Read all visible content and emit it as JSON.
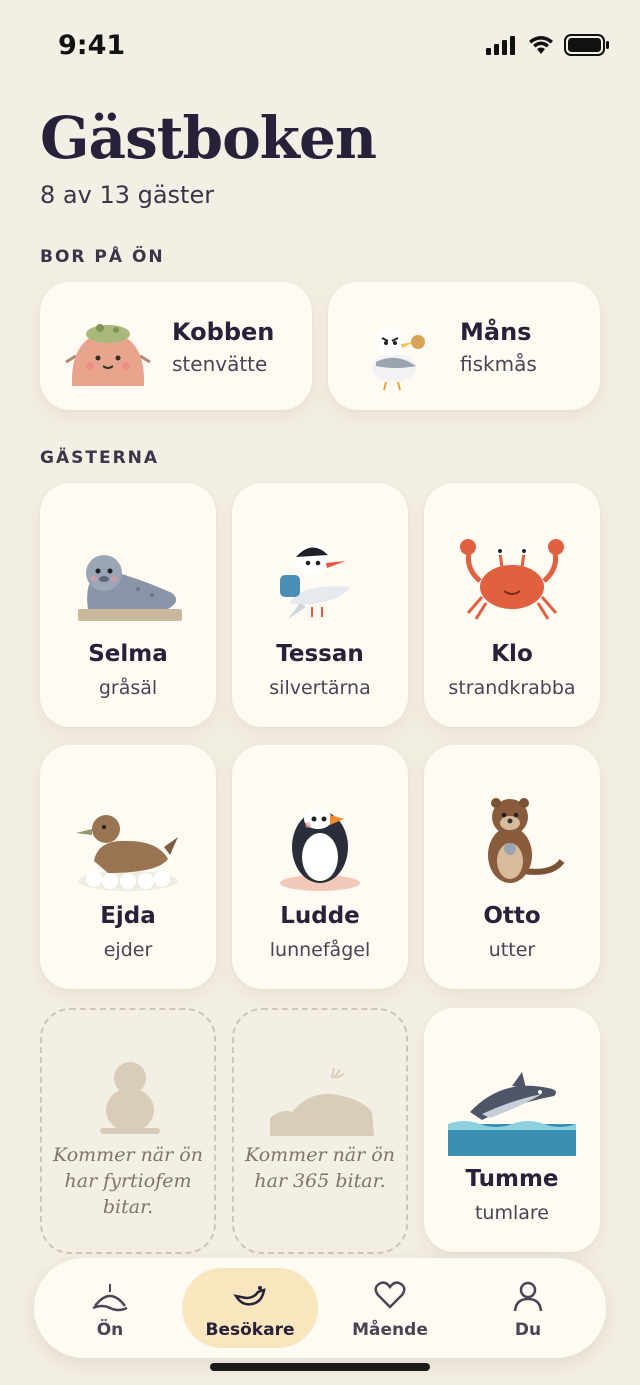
{
  "status_bar": {
    "time": "9:41"
  },
  "header": {
    "title": "Gästboken",
    "subtitle": "8 av 13 gäster"
  },
  "residents": {
    "label": "BOR PÅ ÖN",
    "items": [
      {
        "name": "Kobben",
        "species": "stenvätte"
      },
      {
        "name": "Måns",
        "species": "fiskmås"
      }
    ]
  },
  "guests": {
    "label": "GÄSTERNA",
    "items": [
      {
        "name": "Selma",
        "species": "gråsäl"
      },
      {
        "name": "Tessan",
        "species": "silvertärna"
      },
      {
        "name": "Klo",
        "species": "strandkrabba"
      },
      {
        "name": "Ejda",
        "species": "ejder"
      },
      {
        "name": "Ludde",
        "species": "lunnefågel"
      },
      {
        "name": "Otto",
        "species": "utter"
      },
      {
        "name": "Tumme",
        "species": "tumlare"
      }
    ],
    "locked": [
      {
        "message": "Kommer när ön har fyrtiofem bitar."
      },
      {
        "message": "Kommer när ön har 365 bitar."
      }
    ]
  },
  "tabbar": {
    "tabs": [
      {
        "label": "Ön",
        "icon": "island-icon"
      },
      {
        "label": "Besökare",
        "icon": "bird-icon",
        "active": true
      },
      {
        "label": "Mående",
        "icon": "heart-icon"
      },
      {
        "label": "Du",
        "icon": "person-icon"
      }
    ]
  },
  "colors": {
    "background": "#f4efe4",
    "card": "#fffbf2",
    "active_tab": "#f9e6bf",
    "text": "#27223a"
  }
}
